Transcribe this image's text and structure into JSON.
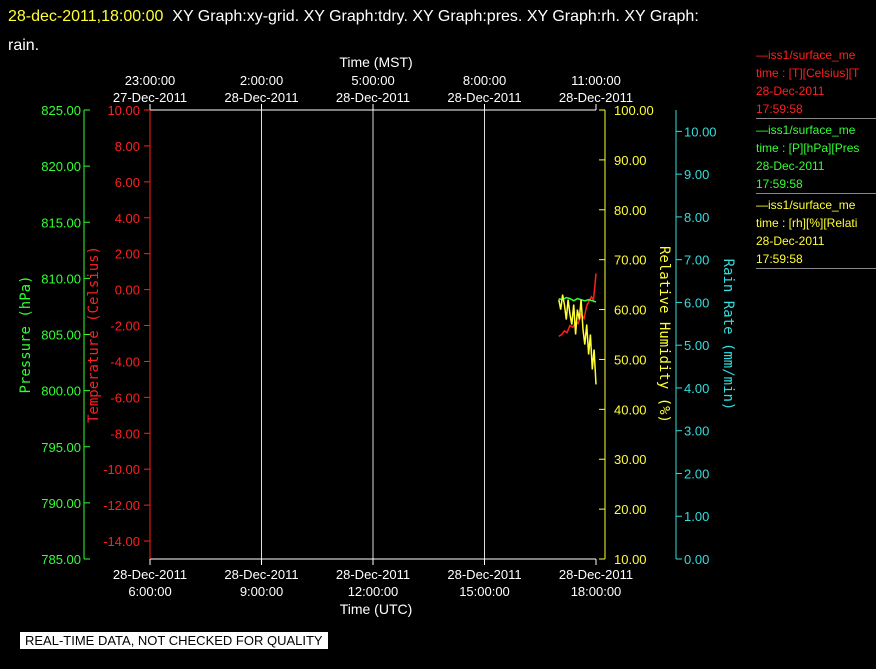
{
  "header": {
    "timestamp": "28-dec-2011,18:00:00",
    "graphs": "XY Graph:xy-grid.  XY Graph:tdry.  XY Graph:pres.  XY Graph:rh.  XY Graph:",
    "graphs_cont": "rain."
  },
  "legend": [
    {
      "name": "—iss1/surface_me",
      "desc": "time : [T][Celsius][T",
      "date": "28-Dec-2011",
      "time": "17:59:58",
      "color": "#ff2020"
    },
    {
      "name": "—iss1/surface_me",
      "desc": "time : [P][hPa][Pres",
      "date": "28-Dec-2011",
      "time": "17:59:58",
      "color": "#33ff33"
    },
    {
      "name": "—iss1/surface_me",
      "desc": "time : [rh][%][Relati",
      "date": "28-Dec-2011",
      "time": "17:59:58",
      "color": "#ffff33"
    }
  ],
  "footer": {
    "qc_notice": "REAL-TIME DATA, NOT CHECKED FOR QUALITY"
  },
  "chart_data": {
    "type": "line",
    "grid": "vertical",
    "x_top": {
      "label": "Time (MST)",
      "ticks": [
        {
          "time": "23:00:00",
          "date": "27-Dec-2011"
        },
        {
          "time": "2:00:00",
          "date": "28-Dec-2011"
        },
        {
          "time": "5:00:00",
          "date": "28-Dec-2011"
        },
        {
          "time": "8:00:00",
          "date": "28-Dec-2011"
        },
        {
          "time": "11:00:00",
          "date": "28-Dec-2011"
        }
      ]
    },
    "x_bottom": {
      "label": "Time (UTC)",
      "range": [
        "2011-12-28 06:00",
        "2011-12-28 18:00"
      ],
      "ticks": [
        {
          "date": "28-Dec-2011",
          "time": "6:00:00"
        },
        {
          "date": "28-Dec-2011",
          "time": "9:00:00"
        },
        {
          "date": "28-Dec-2011",
          "time": "12:00:00"
        },
        {
          "date": "28-Dec-2011",
          "time": "15:00:00"
        },
        {
          "date": "28-Dec-2011",
          "time": "18:00:00"
        }
      ]
    },
    "axes": {
      "pressure": {
        "label": "Pressure (hPa)",
        "ylim": [
          785,
          825
        ],
        "ticks": [
          "785.00",
          "790.00",
          "795.00",
          "800.00",
          "805.00",
          "810.00",
          "815.00",
          "820.00",
          "825.00"
        ],
        "color": "#33ff33"
      },
      "temperature": {
        "label": "Temperature (Celsius)",
        "ylim": [
          -15,
          10
        ],
        "ticks": [
          "-14.00",
          "-12.00",
          "-10.00",
          "-8.00",
          "-6.00",
          "-4.00",
          "-2.00",
          "0.00",
          "2.00",
          "4.00",
          "6.00",
          "8.00",
          "10.00"
        ],
        "color": "#ff2020"
      },
      "rh": {
        "label": "Relative Humidity (%)",
        "ylim": [
          10,
          100
        ],
        "ticks": [
          "10.00",
          "20.00",
          "30.00",
          "40.00",
          "50.00",
          "60.00",
          "70.00",
          "80.00",
          "90.00",
          "100.00"
        ],
        "color": "#ffff33"
      },
      "rain": {
        "label": "Rain Rate (mm/min)",
        "ylim": [
          0,
          10.5
        ],
        "ticks": [
          "0.00",
          "1.00",
          "2.00",
          "3.00",
          "4.00",
          "5.00",
          "6.00",
          "7.00",
          "8.00",
          "9.00",
          "10.00"
        ],
        "color": "#33dddd"
      }
    },
    "series": [
      {
        "name": "iss1/surface_me T",
        "axis": "temperature",
        "color": "#ff2020",
        "x": [
          17.0,
          17.08,
          17.15,
          17.22,
          17.3,
          17.38,
          17.45,
          17.52,
          17.6,
          17.68,
          17.75,
          17.82,
          17.88,
          17.93,
          17.97,
          18.0
        ],
        "values": [
          -2.6,
          -2.5,
          -2.3,
          -2.4,
          -2.0,
          -2.1,
          -1.8,
          -1.9,
          -1.4,
          -1.6,
          -0.9,
          -0.6,
          -0.4,
          -0.6,
          0.2,
          0.9
        ]
      },
      {
        "name": "iss1/surface_me P",
        "axis": "pressure",
        "color": "#33ff33",
        "x": [
          17.0,
          17.1,
          17.2,
          17.3,
          17.4,
          17.5,
          17.6,
          17.7,
          17.8,
          17.9,
          18.0
        ],
        "values": [
          808.2,
          808.1,
          808.3,
          808.2,
          808.0,
          808.2,
          808.1,
          808.0,
          808.1,
          808.0,
          807.9
        ]
      },
      {
        "name": "iss1/surface_me rh",
        "axis": "rh",
        "color": "#ffff33",
        "x": [
          17.0,
          17.05,
          17.1,
          17.15,
          17.2,
          17.25,
          17.3,
          17.35,
          17.4,
          17.45,
          17.5,
          17.55,
          17.6,
          17.65,
          17.7,
          17.75,
          17.8,
          17.85,
          17.9,
          17.95,
          18.0
        ],
        "values": [
          62,
          60,
          63,
          61,
          58,
          62,
          59,
          57,
          61,
          55,
          60,
          58,
          62,
          56,
          53,
          57,
          51,
          55,
          48,
          52,
          45
        ]
      }
    ]
  }
}
